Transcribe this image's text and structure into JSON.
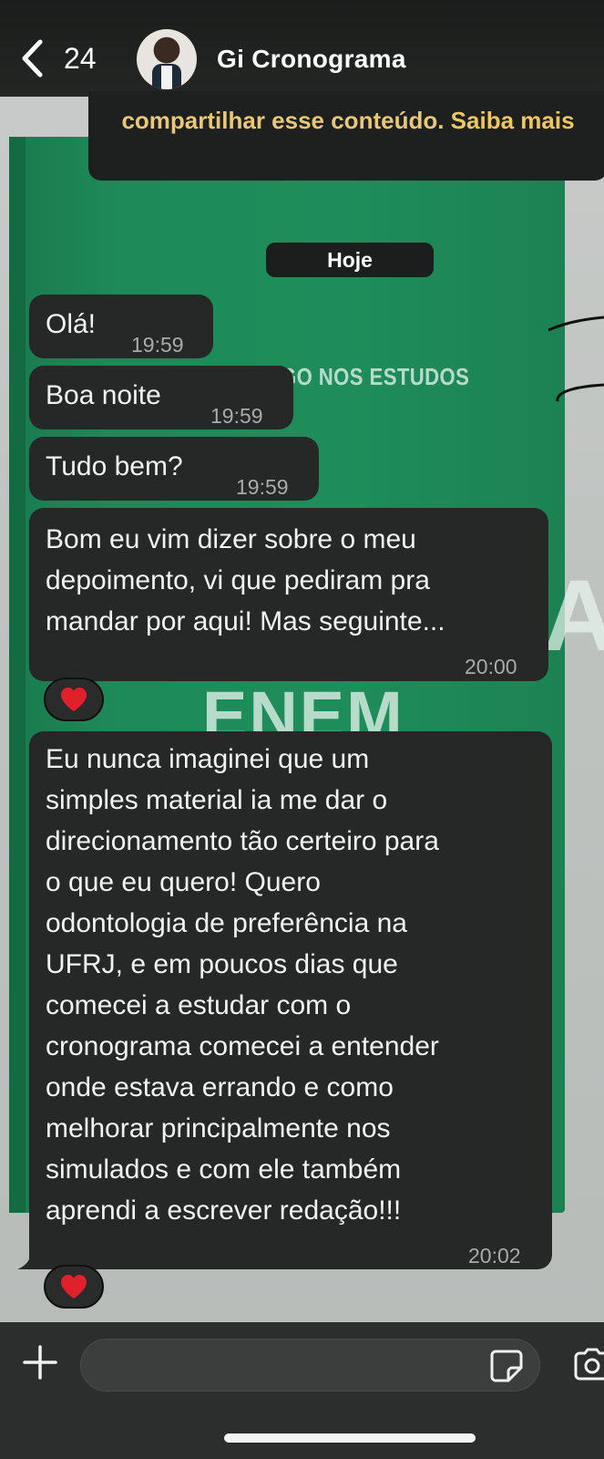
{
  "header": {
    "back_count": "24",
    "title": "Gi  Cronograma"
  },
  "notice": {
    "text": "compartilhar esse conteúdo.",
    "link": "Saiba mais"
  },
  "day_label": "Hoje",
  "wallpaper": {
    "line1": "GO NOS ESTUDOS",
    "line2": "ENEM",
    "letter": "A"
  },
  "messages": [
    {
      "lines": [
        "Olá!"
      ],
      "time": "19:59",
      "reaction": null
    },
    {
      "lines": [
        "Boa noite"
      ],
      "time": "19:59",
      "reaction": null
    },
    {
      "lines": [
        "Tudo bem?"
      ],
      "time": "19:59",
      "reaction": null
    },
    {
      "lines": [
        "Bom eu vim dizer sobre o meu",
        "depoimento, vi que pediram pra",
        "mandar por aqui! Mas seguinte..."
      ],
      "time": "20:00",
      "reaction": "heart"
    },
    {
      "lines": [
        "Eu nunca imaginei que um",
        "simples material ia me dar o",
        "direcionamento tão certeiro para",
        "o que eu quero! Quero",
        "odontologia de preferência na",
        "UFRJ, e em poucos dias que",
        "comecei a estudar com o",
        "cronograma comecei a entender",
        "onde estava errando e como",
        "melhorar principalmente nos",
        "simulados e com ele também",
        "aprendi a escrever redação!!!"
      ],
      "time": "20:02",
      "reaction": "heart"
    }
  ],
  "input": {
    "value": "",
    "placeholder": ""
  },
  "colors": {
    "bubble": "#262727",
    "header": "#1b1d1c",
    "notice_text": "#e9c778",
    "wallpaper_green": "#1e8a59",
    "heart": "#e0202a"
  }
}
